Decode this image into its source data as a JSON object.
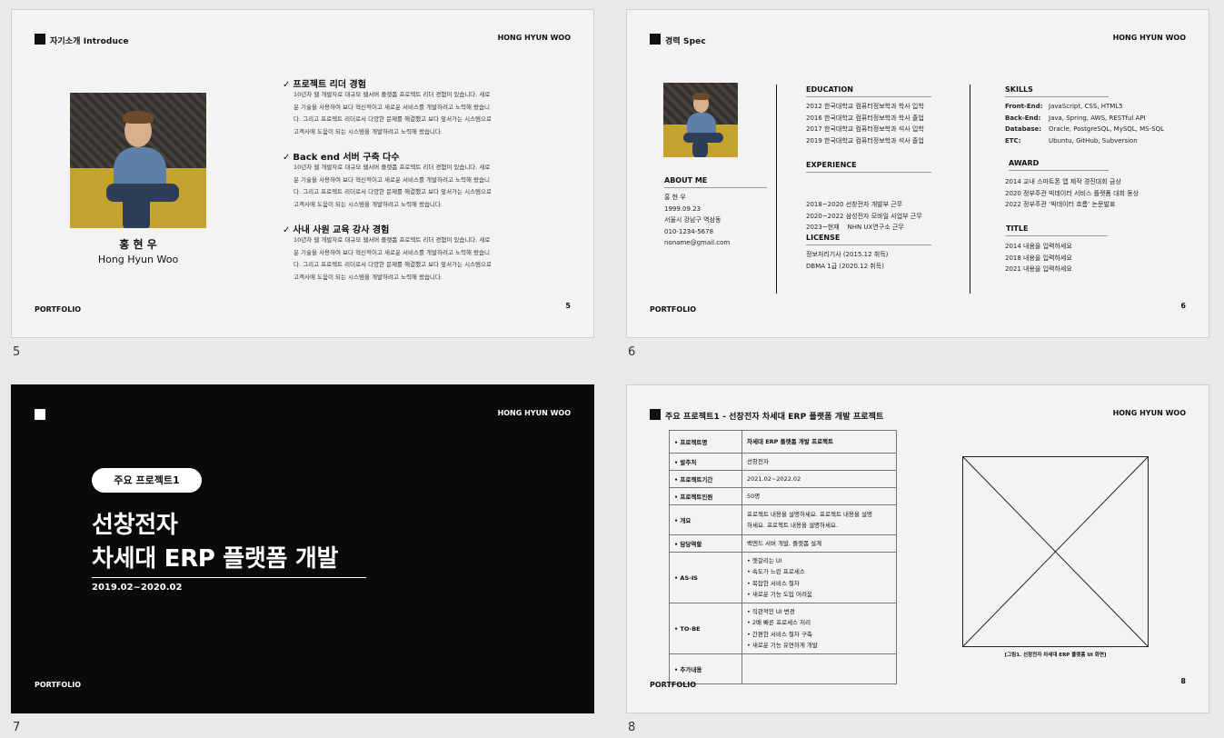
{
  "slides": [
    {
      "number": "5",
      "header": "자기소개 Introduce",
      "brand": "HONG HYUN WOO",
      "footer": "PORTFOLIO",
      "page": "5",
      "name_ko": "홍 현 우",
      "name_en": "Hong Hyun Woo",
      "items": [
        {
          "title": "프로젝트 리더 경험",
          "lines": [
            "10년차 웹 개발자로 대규모 웹서버 플랫폼 프로젝트 리더 경험이 있습니다. 새로",
            "운 기술을 사용하여 보다 혁신적이고 새로운 서비스를 개발하려고 노력해 왔습니",
            "다. 그리고 프로젝트 리더로서 다양한 문제를 해결했고 보다 앞서가는 시스템으로",
            "고객사에 도움이 되는 시스템을 개발하려고 노력해 왔습니다."
          ]
        },
        {
          "title": "Back end 서버 구축 다수",
          "lines": [
            "10년차 웹 개발자로 대규모 웹서버 플랫폼 프로젝트 리더 경험이 있습니다. 새로",
            "운 기술을 사용하여 보다 혁신적이고 새로운 서비스를 개발하려고 노력해 왔습니",
            "다. 그리고 프로젝트 리더로서 다양한 문제를 해결했고 보다 앞서가는 시스템으로",
            "고객사에 도움이 되는 시스템을 개발하려고 노력해 왔습니다."
          ]
        },
        {
          "title": "사내 사원 교육 강사 경험",
          "lines": [
            "10년차 웹 개발자로 대규모 웹서버 플랫폼 프로젝트 리더 경험이 있습니다. 새로",
            "운 기술을 사용하여 보다 혁신적이고 새로운 서비스를 개발하려고 노력해 왔습니",
            "다. 그리고 프로젝트 리더로서 다양한 문제를 해결했고 보다 앞서가는 시스템으로",
            "고객사에 도움이 되는 시스템을 개발하려고 노력해 왔습니다."
          ]
        }
      ]
    },
    {
      "number": "6",
      "header": "경력 Spec",
      "brand": "HONG HYUN WOO",
      "footer": "PORTFOLIO",
      "page": "6",
      "about": {
        "title": "ABOUT ME",
        "lines": [
          "홍 현 우",
          "1999.09.23",
          "서울시 강남구 역삼동",
          "010-1234-5678",
          "noname@gmail.com"
        ]
      },
      "education": {
        "title": "EDUCATION",
        "lines": [
          "2012 한국대학교 컴퓨터정보학과 학사 입학",
          "2016 한국대학교 컴퓨터정보학과 학사 졸업",
          "2017 한국대학교 컴퓨터정보학과 석사 입학",
          "2019 한국대학교 컴퓨터정보학과 석사 졸업"
        ]
      },
      "experience": {
        "title": "EXPERIENCE",
        "lines": [
          "2018~2020 선창전자 개발부 근무",
          "2020~2022 삼성전자 모바일 사업부 근무",
          "2023~현재    NHN UX연구소 근무"
        ]
      },
      "license": {
        "title": "LICENSE",
        "lines": [
          "정보처리기사 (2015.12 취득)",
          "DBMA 1급 (2020.12 취득)"
        ]
      },
      "skills": {
        "title": "SKILLS",
        "rows": [
          {
            "k": "Front-End:",
            "v": "JavaScript, CSS, HTML5"
          },
          {
            "k": "Back-End:",
            "v": "Java, Spring, AWS, RESTful API"
          },
          {
            "k": "Database:",
            "v": "Oracle, PostgreSQL, MySQL, MS-SQL"
          },
          {
            "k": "ETC:",
            "v": "Ubuntu, GitHub, Subversion"
          }
        ]
      },
      "award": {
        "title": "AWARD",
        "lines": [
          "2014 교내 스마트폰 앱 제작 경진대회 금상",
          "2020 정부주관 빅데이터 서비스 플랫폼 대회 동상",
          "2022 정부주관 ‘빅데이터 흐름’ 논문발표"
        ]
      },
      "titlesec": {
        "title": "TITLE",
        "lines": [
          "2014 내용을 입력하세요",
          "2018 내용을 입력하세요",
          "2021 내용을 입력하세요"
        ]
      }
    },
    {
      "number": "7",
      "brand": "HONG HYUN WOO",
      "footer": "PORTFOLIO",
      "pill": "주요 프로젝트1",
      "line1": "선창전자",
      "line2": "차세대 ERP 플랫폼 개발",
      "dates": "2019.02~2020.02"
    },
    {
      "number": "8",
      "header": "주요 프로젝트1 - 선창전자 차세대 ERP 플랫폼 개발 프로젝트",
      "brand": "HONG HYUN WOO",
      "footer": "PORTFOLIO",
      "page": "8",
      "caption": "[그림1. 선창전자 차세대 ERP 플랫폼 UI 화면]",
      "rows": [
        {
          "k": "프로젝트명",
          "v": [
            "차세대 ERP 플랫폼 개발 프로젝트"
          ]
        },
        {
          "k": "발주처",
          "v": [
            "선창전자"
          ]
        },
        {
          "k": "프로젝트기간",
          "v": [
            "2021.02~2022.02"
          ]
        },
        {
          "k": "프로젝트인원",
          "v": [
            "50명"
          ]
        },
        {
          "k": "개요",
          "v": [
            "프로젝트 내용을 설명하세요. 프로젝트 내용을 설명",
            "하세요. 프로젝트 내용을 설명하세요."
          ]
        },
        {
          "k": "담당역할",
          "v": [
            "백엔드 서버 개발, 플랫폼 설계"
          ]
        },
        {
          "k": "AS-IS",
          "v": [
            "• 헷갈리는 UI",
            "• 속도가 느린 프로세스",
            "• 복잡한 서비스 절차",
            "• 새로운 기능 도입 어려움"
          ]
        },
        {
          "k": "TO-BE",
          "v": [
            "• 직관적인 UI 변경",
            "• 2배 빠른 프로세스 처리",
            "• 간편한 서비스 절차 구축",
            "• 새로운 기능 유연하게 개발"
          ]
        },
        {
          "k": "추가내용",
          "v": [
            ""
          ]
        }
      ]
    }
  ]
}
